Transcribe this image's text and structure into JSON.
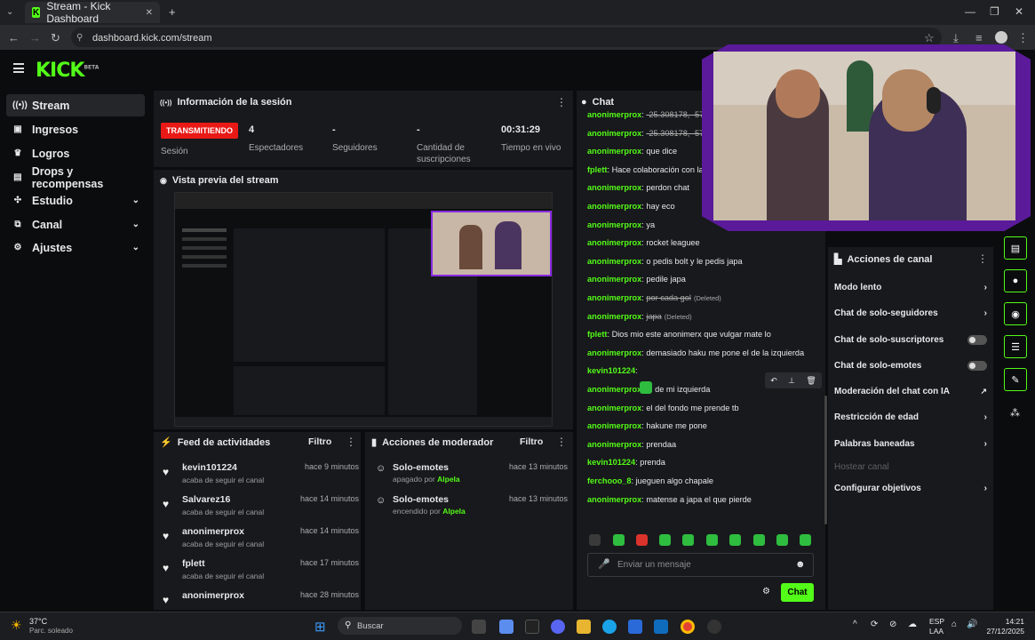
{
  "browser": {
    "tab_title": "Stream - Kick Dashboard",
    "tab_close": "✕",
    "new_tab": "+",
    "url": "dashboard.kick.com/stream"
  },
  "app": {
    "logo": "KICK",
    "logo_badge": "BETA"
  },
  "sidebar": {
    "items": [
      {
        "label": "Stream",
        "icon": "broadcast-icon"
      },
      {
        "label": "Ingresos",
        "icon": "money-icon"
      },
      {
        "label": "Logros",
        "icon": "trophy-icon"
      },
      {
        "label": "Drops y recompensas",
        "icon": "gift-icon"
      },
      {
        "label": "Estudio",
        "icon": "palette-icon"
      },
      {
        "label": "Canal",
        "icon": "channel-icon"
      },
      {
        "label": "Ajustes",
        "icon": "gear-icon"
      }
    ]
  },
  "session": {
    "title": "Información de la sesión",
    "status": "TRANSMITIENDO",
    "status_label": "Sesión",
    "viewers_value": "4",
    "viewers_label": "Espectadores",
    "followers_value": "-",
    "followers_label": "Seguidores",
    "subs_value": "-",
    "subs_label": "Cantidad de suscripciones",
    "time_value": "00:31:29",
    "time_label": "Tiempo en vivo"
  },
  "preview": {
    "title": "Vista previa del stream"
  },
  "feed": {
    "title": "Feed de actividades",
    "filter": "Filtro",
    "items": [
      {
        "name": "kevin101224",
        "sub": "acaba de seguir el canal",
        "time": "hace 9 minutos"
      },
      {
        "name": "Salvarez16",
        "sub": "acaba de seguir el canal",
        "time": "hace 14 minutos"
      },
      {
        "name": "anonimerprox",
        "sub": "acaba de seguir el canal",
        "time": "hace 14 minutos"
      },
      {
        "name": "fplett",
        "sub": "acaba de seguir el canal",
        "time": "hace 17 minutos"
      },
      {
        "name": "anonimerprox",
        "sub": "",
        "time": "hace 28 minutos"
      }
    ]
  },
  "mod": {
    "title": "Acciones de moderador",
    "filter": "Filtro",
    "items": [
      {
        "name": "Solo-emotes",
        "sub": "apagado por",
        "by": "Alpela",
        "time": "hace 13 minutos"
      },
      {
        "name": "Solo-emotes",
        "sub": "encendido por",
        "by": "Alpela",
        "time": "hace 13 minutos"
      }
    ]
  },
  "chat": {
    "title": "Chat",
    "messages": [
      {
        "user": "anonimerprox",
        "text": "-25.308178, -57.6",
        "deleted": true
      },
      {
        "user": "anonimerprox",
        "text": "-25.308178, -57.6",
        "deleted": true
      },
      {
        "user": "anonimerprox",
        "text": "que dice"
      },
      {
        "user": "fplett",
        "text": "Hace colaboración con la"
      },
      {
        "user": "anonimerprox",
        "text": "perdon chat"
      },
      {
        "user": "anonimerprox",
        "text": "hay eco"
      },
      {
        "user": "anonimerprox",
        "text": "ya"
      },
      {
        "user": "anonimerprox",
        "text": "rocket leaguee"
      },
      {
        "user": "anonimerprox",
        "text": "o pedis bolt y le pedis japa"
      },
      {
        "user": "anonimerprox",
        "text": "pedile japa"
      },
      {
        "user": "anonimerprox",
        "text": "por cada gol",
        "deleted": true,
        "tag": "(Deleted)"
      },
      {
        "user": "anonimerprox",
        "text": "japa",
        "deleted": true,
        "tag": "(Deleted)"
      },
      {
        "user": "fplett",
        "text": "Dios mio este anonimerx que vulgar mate lo"
      },
      {
        "user": "anonimerprox",
        "text": "demasiado haku me pone el de la izquierda"
      },
      {
        "user": "kevin101224",
        "text": ""
      },
      {
        "user": "anonimerprox",
        "text": "el de mi izquierda"
      },
      {
        "user": "anonimerprox",
        "text": "el del fondo me prende tb"
      },
      {
        "user": "anonimerprox",
        "text": "hakune me pone"
      },
      {
        "user": "anonimerprox",
        "text": "prendaa"
      },
      {
        "user": "kevin101224",
        "text": "prenda"
      },
      {
        "user": "ferchooo_8",
        "text": "jueguen algo chapale"
      },
      {
        "user": "anonimerprox",
        "text": "matense a japa el que pierde"
      }
    ],
    "input_placeholder": "Enviar un mensaje",
    "send": "Chat"
  },
  "actions": {
    "title": "Acciones de canal",
    "items": [
      {
        "label": "Modo lento",
        "control": "chevron"
      },
      {
        "label": "Chat de solo-seguidores",
        "control": "chevron"
      },
      {
        "label": "Chat de solo-suscriptores",
        "control": "toggle"
      },
      {
        "label": "Chat de solo-emotes",
        "control": "toggle"
      },
      {
        "label": "Moderación del chat con IA",
        "control": "external"
      },
      {
        "label": "Restricción de edad",
        "control": "chevron"
      },
      {
        "label": "Palabras baneadas",
        "control": "chevron"
      },
      {
        "label": "Hostear canal",
        "control": "none",
        "disabled": true
      },
      {
        "label": "Configurar objetivos",
        "control": "chevron"
      }
    ]
  },
  "taskbar": {
    "weather_temp": "37°C",
    "weather_desc": "Parc. soleado",
    "search": "Buscar",
    "lang1": "ESP",
    "lang2": "LAA",
    "time": "14:21",
    "date": "27/12/2025"
  },
  "colors": {
    "accent": "#53fc18",
    "live": "#e91916",
    "overlay": "#8a2be2"
  }
}
